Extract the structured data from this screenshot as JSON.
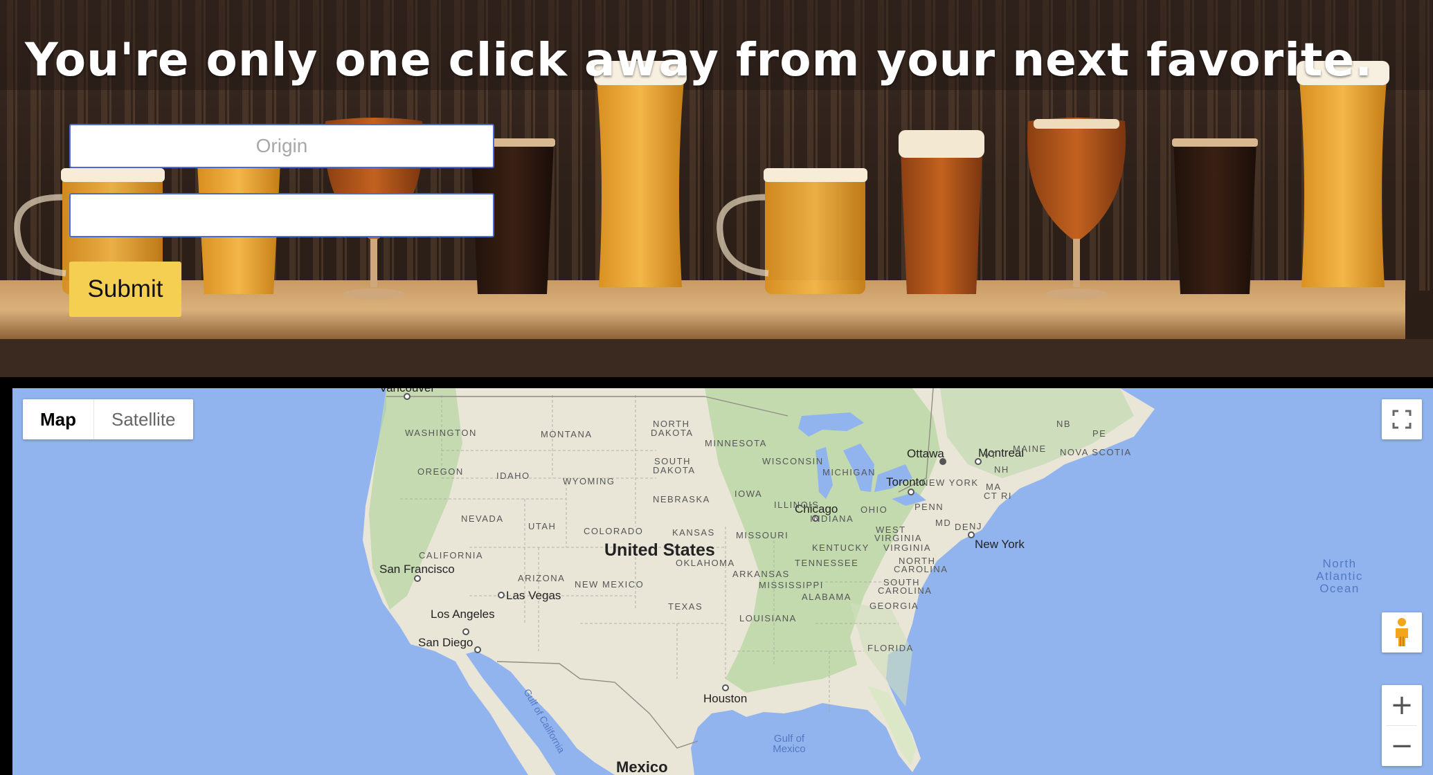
{
  "hero": {
    "title": "You're only one click away from your next favorite.",
    "origin_placeholder": "Origin",
    "destination_value": "",
    "submit_label": "Submit"
  },
  "map": {
    "type_control": {
      "map_label": "Map",
      "satellite_label": "Satellite"
    },
    "icons": {
      "fullscreen": "fullscreen-icon",
      "pegman": "pegman-icon",
      "zoom_in": "+",
      "zoom_out": "−"
    },
    "cities": {
      "vancouver": "Vancouver",
      "ottawa": "Ottawa",
      "montreal": "Montreal",
      "toronto": "Toronto",
      "chicago": "Chicago",
      "new_york": "New York",
      "san_francisco": "San Francisco",
      "las_vegas": "Las Vegas",
      "los_angeles": "Los Angeles",
      "san_diego": "San Diego",
      "houston": "Houston",
      "mexico": "Mexico"
    },
    "country": "United States",
    "states": {
      "washington": "WASHINGTON",
      "montana": "MONTANA",
      "north_dakota_1": "NORTH",
      "north_dakota_2": "DAKOTA",
      "minnesota": "MINNESOTA",
      "south_dakota_1": "SOUTH",
      "south_dakota_2": "DAKOTA",
      "oregon": "OREGON",
      "idaho": "IDAHO",
      "wyoming": "WYOMING",
      "wisconsin": "WISCONSIN",
      "michigan": "MICHIGAN",
      "iowa": "IOWA",
      "nebraska": "NEBRASKA",
      "illinois": "ILLINOIS",
      "nevada": "NEVADA",
      "utah": "UTAH",
      "colorado": "COLORADO",
      "kansas": "KANSAS",
      "missouri": "MISSOURI",
      "indiana": "INDIANA",
      "ohio": "OHIO",
      "penn": "PENN",
      "new_york_state": "NEW YORK",
      "california": "CALIFORNIA",
      "arizona": "ARIZONA",
      "new_mexico": "NEW MEXICO",
      "oklahoma": "OKLAHOMA",
      "arkansas": "ARKANSAS",
      "mississippi": "MISSISSIPPI",
      "alabama": "ALABAMA",
      "georgia": "GEORGIA",
      "texas": "TEXAS",
      "louisiana": "LOUISIANA",
      "florida": "FLORIDA",
      "tennessee": "TENNESSEE",
      "kentucky": "KENTUCKY",
      "virginia": "VIRGINIA",
      "west_virginia_1": "WEST",
      "west_virginia_2": "VIRGINIA",
      "north_carolina_1": "NORTH",
      "north_carolina_2": "CAROLINA",
      "south_carolina_1": "SOUTH",
      "south_carolina_2": "CAROLINA",
      "maine": "MAINE",
      "nova_scotia": "NOVA SCOTIA",
      "nb": "NB",
      "pe": "PE",
      "vt": "VT",
      "nh": "NH",
      "ma": "MA",
      "ct": "CT",
      "ri": "RI",
      "md": "MD",
      "de": "DE",
      "nj": "NJ"
    },
    "water": {
      "atlantic_1": "North",
      "atlantic_2": "Atlantic",
      "atlantic_3": "Ocean",
      "gulf_mexico_1": "Gulf of",
      "gulf_mexico_2": "Mexico",
      "gulf_california": "Gulf of California"
    },
    "colors": {
      "ocean": "#92b4ee",
      "land": "#e9e6d8",
      "forest": "#bcd7a8",
      "lakes": "#92b4ee"
    }
  }
}
